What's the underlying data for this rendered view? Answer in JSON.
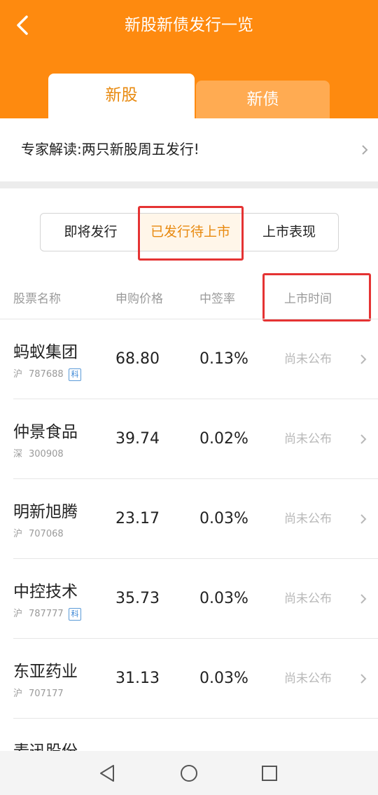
{
  "header": {
    "title": "新股新债发行一览",
    "tabs": [
      {
        "label": "新股",
        "active": true
      },
      {
        "label": "新债",
        "active": false
      }
    ],
    "color": "#fe8a0f"
  },
  "banner": {
    "text": "专家解读:两只新股周五发行!"
  },
  "filters": [
    {
      "label": "即将发行",
      "active": false
    },
    {
      "label": "已发行待上市",
      "active": true
    },
    {
      "label": "上市表现",
      "active": false
    }
  ],
  "columns": [
    "股票名称",
    "申购价格",
    "中签率",
    "上市时间"
  ],
  "rows": [
    {
      "name": "蚂蚁集团",
      "market": "沪",
      "code": "787688",
      "badge": "科",
      "price": "68.80",
      "rate": "0.13%",
      "listing": "尚未公布"
    },
    {
      "name": "仲景食品",
      "market": "深",
      "code": "300908",
      "badge": "",
      "price": "39.74",
      "rate": "0.02%",
      "listing": "尚未公布"
    },
    {
      "name": "明新旭腾",
      "market": "沪",
      "code": "707068",
      "badge": "",
      "price": "23.17",
      "rate": "0.03%",
      "listing": "尚未公布"
    },
    {
      "name": "中控技术",
      "market": "沪",
      "code": "787777",
      "badge": "科",
      "price": "35.73",
      "rate": "0.03%",
      "listing": "尚未公布"
    },
    {
      "name": "东亚药业",
      "market": "沪",
      "code": "707177",
      "badge": "",
      "price": "31.13",
      "rate": "0.03%",
      "listing": "尚未公布"
    },
    {
      "name": "麦迅股份",
      "market": "",
      "code": "",
      "badge": "",
      "price": "",
      "rate": "",
      "listing": ""
    }
  ],
  "icons": {
    "back": "chevron-left-icon",
    "row_arrow": "chevron-right-icon",
    "nav": [
      "back-triangle-icon",
      "home-circle-icon",
      "recents-square-icon"
    ]
  }
}
